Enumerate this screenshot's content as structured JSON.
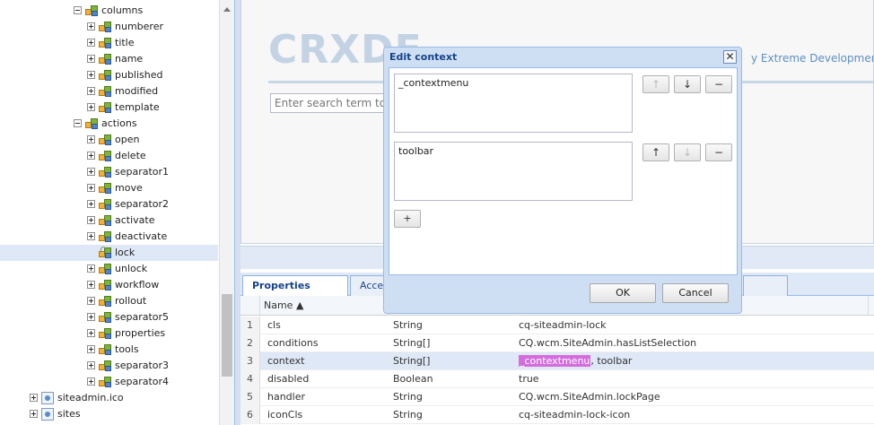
{
  "tree": {
    "nodes": [
      {
        "label": "columns",
        "depth": 1,
        "expanded": true
      },
      {
        "label": "numberer",
        "depth": 2,
        "expanded": false
      },
      {
        "label": "title",
        "depth": 2,
        "expanded": false
      },
      {
        "label": "name",
        "depth": 2,
        "expanded": false
      },
      {
        "label": "published",
        "depth": 2,
        "expanded": false
      },
      {
        "label": "modified",
        "depth": 2,
        "expanded": false
      },
      {
        "label": "template",
        "depth": 2,
        "expanded": false
      },
      {
        "label": "actions",
        "depth": 1,
        "expanded": true
      },
      {
        "label": "open",
        "depth": 2,
        "expanded": false
      },
      {
        "label": "delete",
        "depth": 2,
        "expanded": false
      },
      {
        "label": "separator1",
        "depth": 2,
        "expanded": false
      },
      {
        "label": "move",
        "depth": 2,
        "expanded": false
      },
      {
        "label": "separator2",
        "depth": 2,
        "expanded": false
      },
      {
        "label": "activate",
        "depth": 2,
        "expanded": false
      },
      {
        "label": "deactivate",
        "depth": 2,
        "expanded": false
      },
      {
        "label": "lock",
        "depth": 2,
        "expanded": false,
        "selected": true
      },
      {
        "label": "unlock",
        "depth": 2,
        "expanded": false
      },
      {
        "label": "workflow",
        "depth": 2,
        "expanded": false
      },
      {
        "label": "rollout",
        "depth": 2,
        "expanded": false
      },
      {
        "label": "separator5",
        "depth": 2,
        "expanded": false
      },
      {
        "label": "properties",
        "depth": 2,
        "expanded": false
      },
      {
        "label": "tools",
        "depth": 2,
        "expanded": false
      },
      {
        "label": "separator3",
        "depth": 2,
        "expanded": false
      },
      {
        "label": "separator4",
        "depth": 2,
        "expanded": false
      },
      {
        "label": "siteadmin.ico",
        "depth": 0,
        "expanded": false,
        "file": true
      },
      {
        "label": "sites",
        "depth": 0,
        "expanded": false,
        "file": true
      }
    ]
  },
  "welcome": {
    "logo": "CRXDE",
    "subtitle": "y Extreme Development En",
    "search_placeholder": "Enter search term to se"
  },
  "tabs": {
    "properties": "Properties",
    "access": "Acce"
  },
  "grid": {
    "header_name": "Name ▲",
    "rows": [
      {
        "num": "1",
        "name": "cls",
        "type": "String",
        "value": "cq-siteadmin-lock"
      },
      {
        "num": "2",
        "name": "conditions",
        "type": "String[]",
        "value": "CQ.wcm.SiteAdmin.hasListSelection"
      },
      {
        "num": "3",
        "name": "context",
        "type": "String[]",
        "value_hl": "_contextmenu",
        "value_rest": ", toolbar",
        "selected": true
      },
      {
        "num": "4",
        "name": "disabled",
        "type": "Boolean",
        "value": "true"
      },
      {
        "num": "5",
        "name": "handler",
        "type": "String",
        "value": "CQ.wcm.SiteAdmin.lockPage"
      },
      {
        "num": "6",
        "name": "iconCls",
        "type": "String",
        "value": "cq-siteadmin-lock-icon"
      }
    ]
  },
  "modal": {
    "title": "Edit context",
    "close": "✕",
    "value1": "_contextmenu",
    "value2": "toolbar",
    "up": "↑",
    "down": "↓",
    "remove": "−",
    "add": "+",
    "ok": "OK",
    "cancel": "Cancel"
  }
}
